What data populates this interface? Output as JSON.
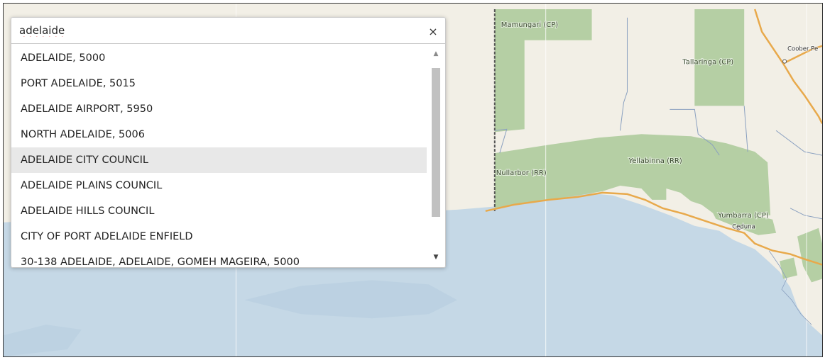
{
  "search": {
    "query": "adelaide",
    "clear_icon": "×",
    "results": [
      "ADELAIDE, 5000",
      "PORT ADELAIDE, 5015",
      "ADELAIDE AIRPORT, 5950",
      "NORTH ADELAIDE, 5006",
      "ADELAIDE CITY COUNCIL",
      "ADELAIDE PLAINS COUNCIL",
      "ADELAIDE HILLS COUNCIL",
      "CITY OF PORT ADELAIDE ENFIELD",
      "30-138 ADELAIDE, ADELAIDE, GOMEH MAGEIRA, 5000"
    ],
    "highlighted_index": 4,
    "scroll_position_fraction": 0.0
  },
  "map": {
    "labels": {
      "mamungari": "Mamungari (CP)",
      "tallaringa": "Tallaringa (CP)",
      "coober_pedy": "Coober Pe",
      "yellabinna": "Yellabinna (RR)",
      "nullarbor": "Nullarbor (RR)",
      "yumbarra": "Yumbarra (CP)",
      "ceduna": "Ceduna"
    },
    "colors": {
      "land": "#f2efe6",
      "water": "#c5d8e6",
      "park": "#b5cfa4",
      "highway": "#e8a94b",
      "boundary": "#8aa0c0"
    }
  }
}
